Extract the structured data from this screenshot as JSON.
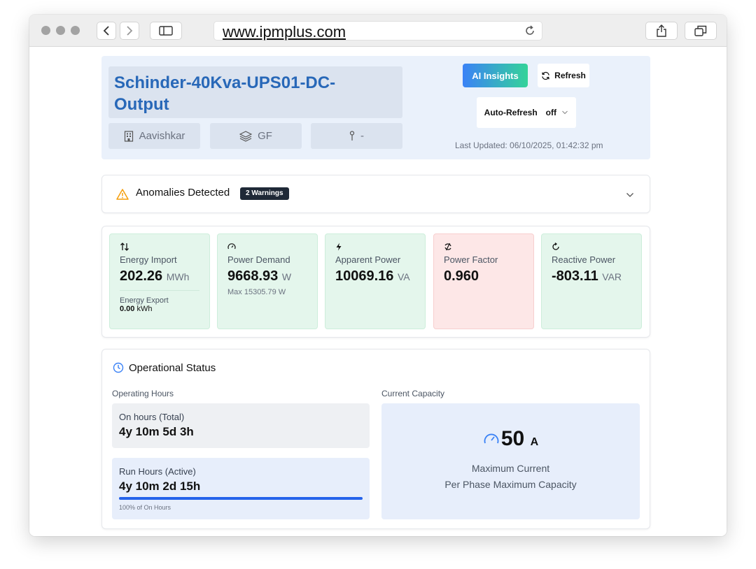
{
  "browser": {
    "url": "www.ipmplus.com"
  },
  "header": {
    "title": "Schinder-40Kva-UPS01-DC-Output",
    "chips": [
      {
        "icon": "building-icon",
        "label": "Aavishkar"
      },
      {
        "icon": "layers-icon",
        "label": "GF"
      },
      {
        "icon": "pin-icon",
        "label": "-"
      }
    ],
    "ai_insights_label": "AI Insights",
    "refresh_label": "Refresh",
    "auto_refresh_label": "Auto-Refresh",
    "auto_refresh_value": "off",
    "last_updated": "Last Updated: 06/10/2025, 01:42:32 pm"
  },
  "anomalies": {
    "label": "Anomalies Detected",
    "badge": "2 Warnings"
  },
  "metrics": [
    {
      "icon": "arrows-updown-icon",
      "label": "Energy Import",
      "value": "202.26",
      "unit": "MWh",
      "sub_label": "Energy Export",
      "sub_value": "0.00",
      "sub_unit": "kWh",
      "status": "normal"
    },
    {
      "icon": "gauge-icon",
      "label": "Power Demand",
      "value": "9668.93",
      "unit": "W",
      "note": "Max 15305.79 W",
      "status": "normal"
    },
    {
      "icon": "bolt-icon",
      "label": "Apparent Power",
      "value": "10069.16",
      "unit": "VA",
      "status": "normal"
    },
    {
      "icon": "cycle-icon",
      "label": "Power Factor",
      "value": "0.960",
      "unit": "",
      "status": "warning"
    },
    {
      "icon": "rotate-icon",
      "label": "Reactive Power",
      "value": "-803.11",
      "unit": "VAR",
      "status": "normal"
    }
  ],
  "operational_status": {
    "title": "Operational Status",
    "operating_hours_label": "Operating Hours",
    "on_hours_label": "On hours (Total)",
    "on_hours_value": "4y 10m 5d 3h",
    "run_hours_label": "Run Hours (Active)",
    "run_hours_value": "4y 10m 2d 15h",
    "run_hours_percent": 100,
    "run_hours_note": "100% of On Hours",
    "current_capacity_label": "Current Capacity",
    "capacity_value": "50",
    "capacity_unit": "A",
    "capacity_line1": "Maximum Current",
    "capacity_line2": "Per Phase Maximum Capacity"
  },
  "colors": {
    "accent": "#2868b8",
    "card_green": "#e4f6ec",
    "card_red": "#fde7e7",
    "warning": "#f59e0b"
  }
}
